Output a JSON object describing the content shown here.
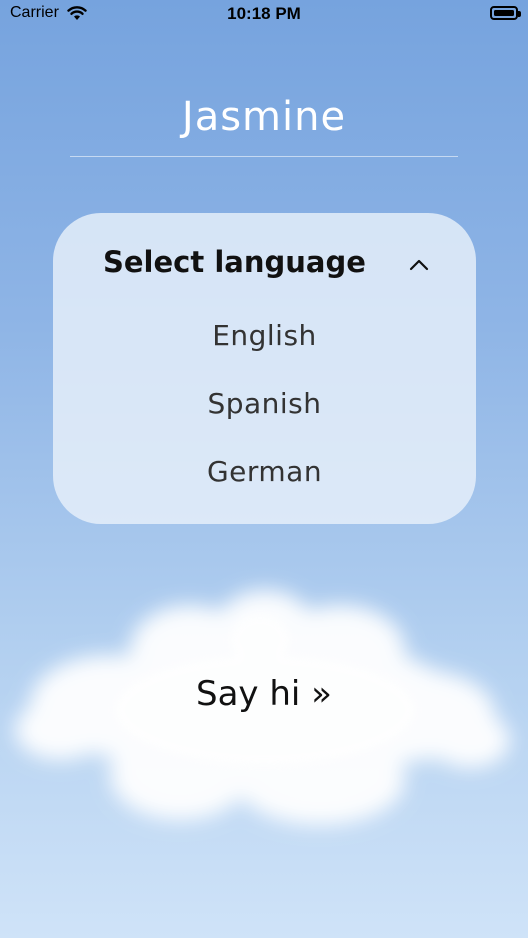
{
  "status_bar": {
    "carrier": "Carrier",
    "time": "10:18 PM"
  },
  "header": {
    "title": "Jasmine"
  },
  "language_picker": {
    "label": "Select language",
    "options": [
      "English",
      "Spanish",
      "German"
    ]
  },
  "action": {
    "say_hi_label": "Say hi »"
  },
  "icons": [
    "wifi-icon",
    "battery-icon",
    "chevron-up-icon"
  ]
}
